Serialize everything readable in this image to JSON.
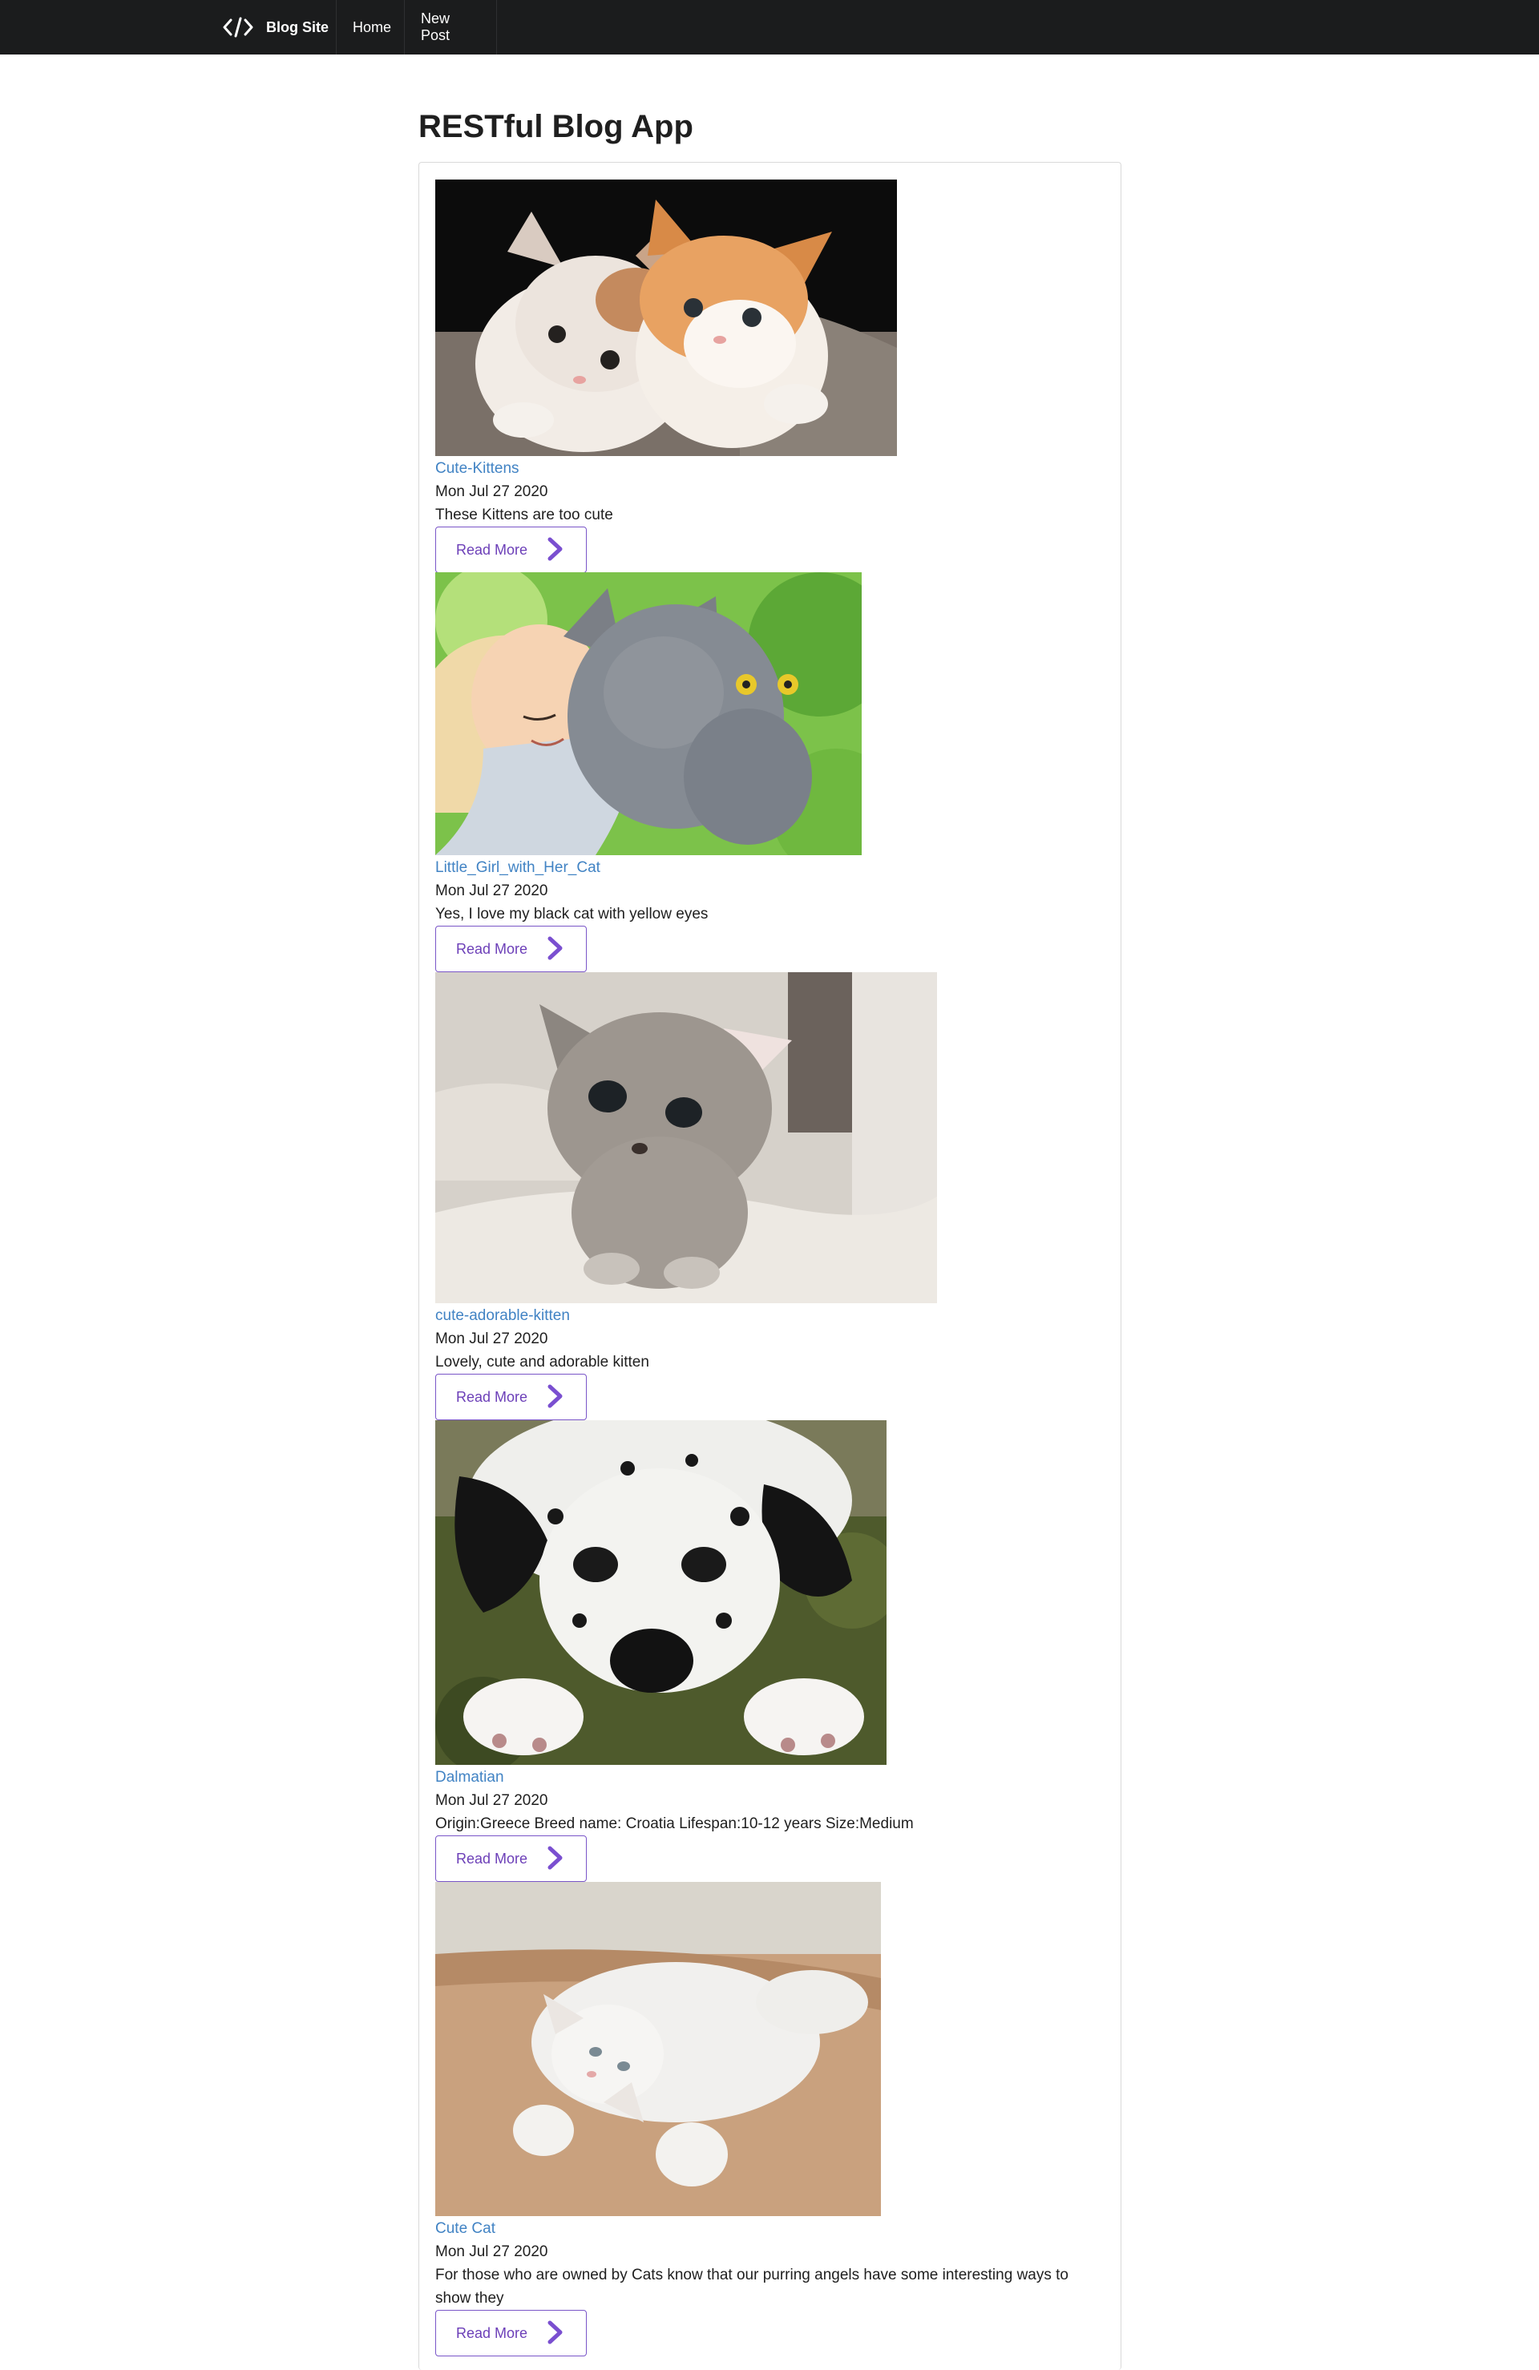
{
  "navbar": {
    "brand_label": "Blog Site",
    "home_label": "Home",
    "new_post_label": "New Post"
  },
  "page": {
    "title": "RESTful Blog App"
  },
  "posts": [
    {
      "title": "Cute-Kittens",
      "date": "Mon Jul 27 2020",
      "body": "These Kittens are too cute",
      "button": "Read More",
      "image_desc": "two-kittens-icon"
    },
    {
      "title": "Little_Girl_with_Her_Cat",
      "date": "Mon Jul 27 2020",
      "body": "Yes, I love my black cat with yellow eyes",
      "button": "Read More",
      "image_desc": "girl-with-cat-icon"
    },
    {
      "title": "cute-adorable-kitten",
      "date": "Mon Jul 27 2020",
      "body": "Lovely, cute and adorable kitten",
      "button": "Read More",
      "image_desc": "grey-kitten-icon"
    },
    {
      "title": "Dalmatian",
      "date": "Mon Jul 27 2020",
      "body": "Origin:Greece Breed name: Croatia Lifespan:10-12 years Size:Medium",
      "button": "Read More",
      "image_desc": "dalmatian-puppy-icon"
    },
    {
      "title": "Cute Cat",
      "date": "Mon Jul 27 2020",
      "body": "For those who are owned by Cats know that our purring angels have some interesting ways to show they",
      "button": "Read More",
      "image_desc": "white-cat-icon"
    }
  ],
  "colors": {
    "navbar_bg": "#1b1c1d",
    "link": "#4183c4",
    "button_accent": "#6c3fb8"
  }
}
